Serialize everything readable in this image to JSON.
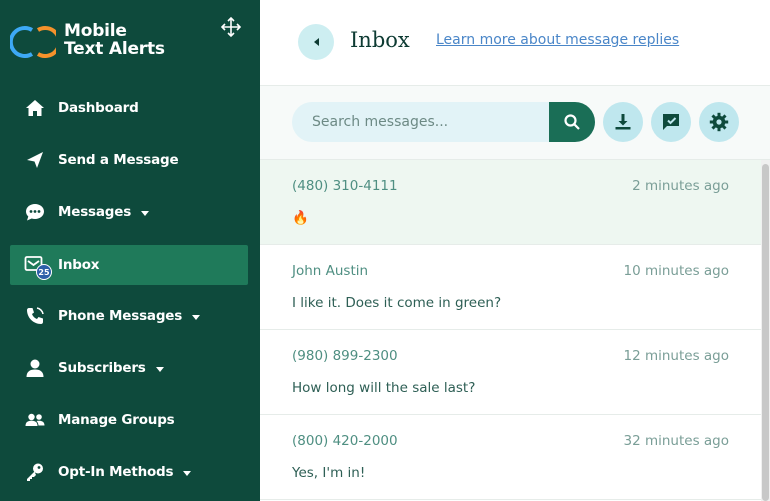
{
  "app": {
    "logo_line1": "Mobile",
    "logo_line2": "Text Alerts"
  },
  "sidebar": {
    "items": [
      {
        "label": "Dashboard",
        "icon": "home-icon"
      },
      {
        "label": "Send a Message",
        "icon": "send-icon"
      },
      {
        "label": "Messages",
        "icon": "chat-icon",
        "dropdown": true
      },
      {
        "label": "Inbox",
        "icon": "inbox-icon",
        "active": true,
        "badge": "25"
      },
      {
        "label": "Phone Messages",
        "icon": "phone-icon",
        "dropdown": true
      },
      {
        "label": "Subscribers",
        "icon": "person-icon",
        "dropdown": true
      },
      {
        "label": "Manage Groups",
        "icon": "group-icon"
      },
      {
        "label": "Opt-In Methods",
        "icon": "key-icon",
        "dropdown": true
      }
    ]
  },
  "header": {
    "title": "Inbox",
    "link": "Learn more about message replies"
  },
  "toolbar": {
    "search_placeholder": "Search messages..."
  },
  "messages": [
    {
      "sender": "(480) 310-4111",
      "time": "2 minutes ago",
      "body": "🔥"
    },
    {
      "sender": "John Austin",
      "time": "10 minutes ago",
      "body": "I like it. Does it come in green?"
    },
    {
      "sender": "(980) 899-2300",
      "time": "12 minutes ago",
      "body": "How long will the sale last?"
    },
    {
      "sender": "(800) 420-2000",
      "time": "32 minutes ago",
      "body": "Yes, I'm in!"
    }
  ],
  "colors": {
    "sidebar": "#0e4a3c",
    "active": "#1f7a5a",
    "accent": "#1a6e56",
    "link": "#4a86c8"
  }
}
